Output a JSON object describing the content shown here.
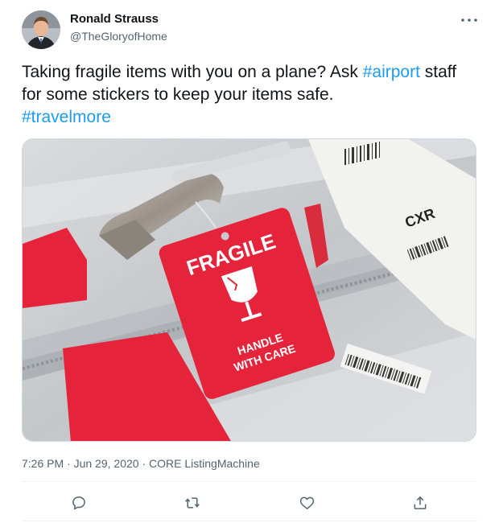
{
  "author": {
    "name": "Ronald Strauss",
    "handle": "@TheGloryofHome"
  },
  "tweet": {
    "text_part1": "Taking fragile items with you on a plane? Ask ",
    "hashtag1": "#airport",
    "text_part2": " staff for some stickers to keep your items safe.",
    "hashtag2": "#travelmore"
  },
  "media": {
    "tag_title": "FRAGILE",
    "tag_line1": "HANDLE",
    "tag_line2": "WITH CARE",
    "bag_tag_code": "CXR",
    "colors": {
      "tag_red": "#e5243b",
      "case_grey": "#c6c9cc"
    }
  },
  "meta": {
    "time": "7:26 PM",
    "date": "Jun 29, 2020",
    "source": "CORE ListingMachine",
    "separator": " · "
  },
  "actions": [
    "reply-icon",
    "retweet-icon",
    "like-icon",
    "share-icon"
  ],
  "colors": {
    "link": "#1d9bf0",
    "secondary_text": "#536471",
    "text": "#0f1419"
  }
}
